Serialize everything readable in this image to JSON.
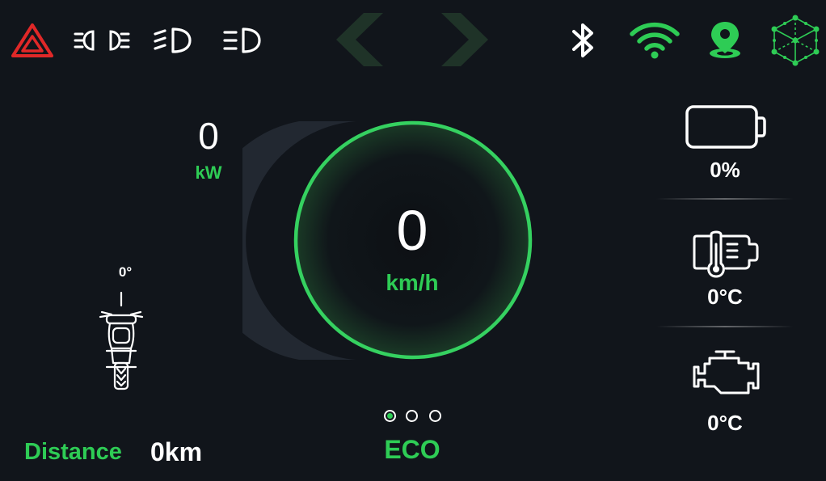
{
  "status_bar": {
    "icons": {
      "hazard": "hazard-warning-icon",
      "position_lights": "position-lights-icon",
      "low_beam": "low-beam-icon",
      "high_beam": "high-beam-icon",
      "turn_left": "turn-left-arrow-icon",
      "turn_right": "turn-right-arrow-icon",
      "bluetooth": "bluetooth-icon",
      "wifi": "wifi-icon",
      "location": "location-pin-icon",
      "network": "network-cube-icon"
    },
    "colors": {
      "hazard": "#e02828",
      "connected": "#2ecc55",
      "inactive_arrow": "#1f3328"
    }
  },
  "power": {
    "value": "0",
    "unit": "kW"
  },
  "speedometer": {
    "value": "0",
    "unit": "km/h",
    "ring_color": "#35d160"
  },
  "tilt": {
    "value": "0°",
    "icon": "motorcycle-lean-icon"
  },
  "drive_mode": {
    "label": "ECO",
    "selected_index": 0,
    "options_count": 3
  },
  "distance": {
    "label": "Distance",
    "value": "0km"
  },
  "battery": {
    "value": "0%",
    "icon": "battery-icon"
  },
  "battery_temp": {
    "value": "0°C",
    "icon": "battery-temperature-icon"
  },
  "engine_temp": {
    "value": "0°C",
    "icon": "engine-icon"
  },
  "theme": {
    "background": "#11151b",
    "accent": "#2ecc55"
  }
}
